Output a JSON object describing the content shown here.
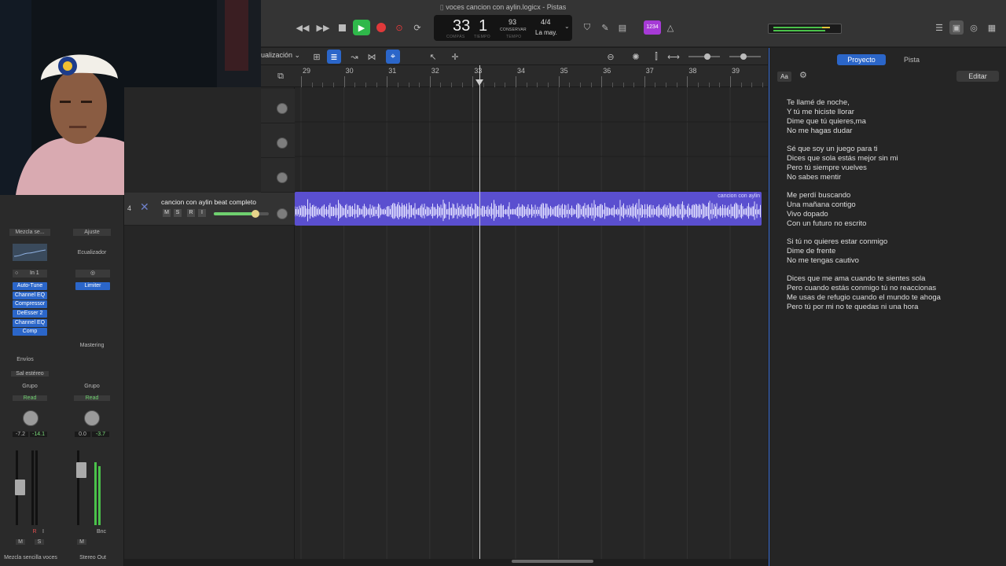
{
  "window": {
    "title": "voces cancion con aylin.logicx - Pistas"
  },
  "transport": {
    "bar": "33",
    "beat": "1",
    "bar_label": "COMPÁS",
    "beat_label": "TIEMPO",
    "tempo": "93",
    "tempo_mode": "CONSERVAR",
    "tempo_label": "TEMPO",
    "signature": "4/4",
    "key": "La may.",
    "count_in": "1234"
  },
  "toolbar": {
    "view_label": "ualización"
  },
  "ruler": {
    "bars": [
      "29",
      "30",
      "31",
      "32",
      "33",
      "34",
      "35",
      "36",
      "37",
      "38",
      "39"
    ]
  },
  "track": {
    "number": "4",
    "name": "cancion con aylin beat completo",
    "region_label": "cancion con aylin",
    "buttons": [
      "M",
      "S",
      "R",
      "I"
    ]
  },
  "inspector": {
    "strip1": {
      "setting": "Mezcla se...",
      "input": "In 1",
      "plugins": [
        "Auto-Tune",
        "Channel EQ",
        "Compressor",
        "DeEsser 2",
        "Channel EQ",
        "Comp"
      ],
      "sends": "Envíos",
      "output": "Sal estéreo",
      "group": "Grupo",
      "automation": "Read",
      "vol": "-7.2",
      "peak": "-14.1",
      "name": "Mezcla sencilla voces",
      "mute": "M",
      "solo": "S",
      "rec": "R",
      "in": "I"
    },
    "strip2": {
      "setting": "Ajuste",
      "eq": "Ecualizador",
      "plugins": [
        "Limiter"
      ],
      "mastering": "Mastering",
      "group": "Grupo",
      "automation": "Read",
      "vol": "0.0",
      "peak": "-3.7",
      "bnc": "Bnc",
      "mute": "M",
      "name": "Stereo Out"
    }
  },
  "right_panel": {
    "tabs": [
      "Proyecto",
      "Pista"
    ],
    "font_button": "Aa",
    "edit_button": "Editar",
    "lyrics": [
      [
        "Te llamé de noche,",
        "Y tú me hiciste llorar",
        "Dime que tú quieres,ma",
        "No me hagas dudar"
      ],
      [
        "Sé que soy un juego para ti",
        "Dices que sola estás mejor sin mi",
        "Pero tú siempre vuelves",
        "No sabes mentir"
      ],
      [
        "Me perdí buscando",
        "Una mañana contigo",
        "Vivo dopado",
        "Con un futuro no escrito"
      ],
      [
        "Si tú no quieres estar conmigo",
        "Dime de frente",
        "No me tengas cautivo"
      ],
      [
        "Dices que me ama cuando te sientes sola",
        "Pero cuando estás conmigo tú no reaccionas",
        "Me usas de refugio cuando el mundo te ahoga",
        "Pero tú por mi no te quedas ni una hora"
      ]
    ]
  },
  "colors": {
    "accent": "#2b66c9",
    "region": "#5a4fcf",
    "play": "#2fb84a",
    "record": "#e0393a"
  }
}
